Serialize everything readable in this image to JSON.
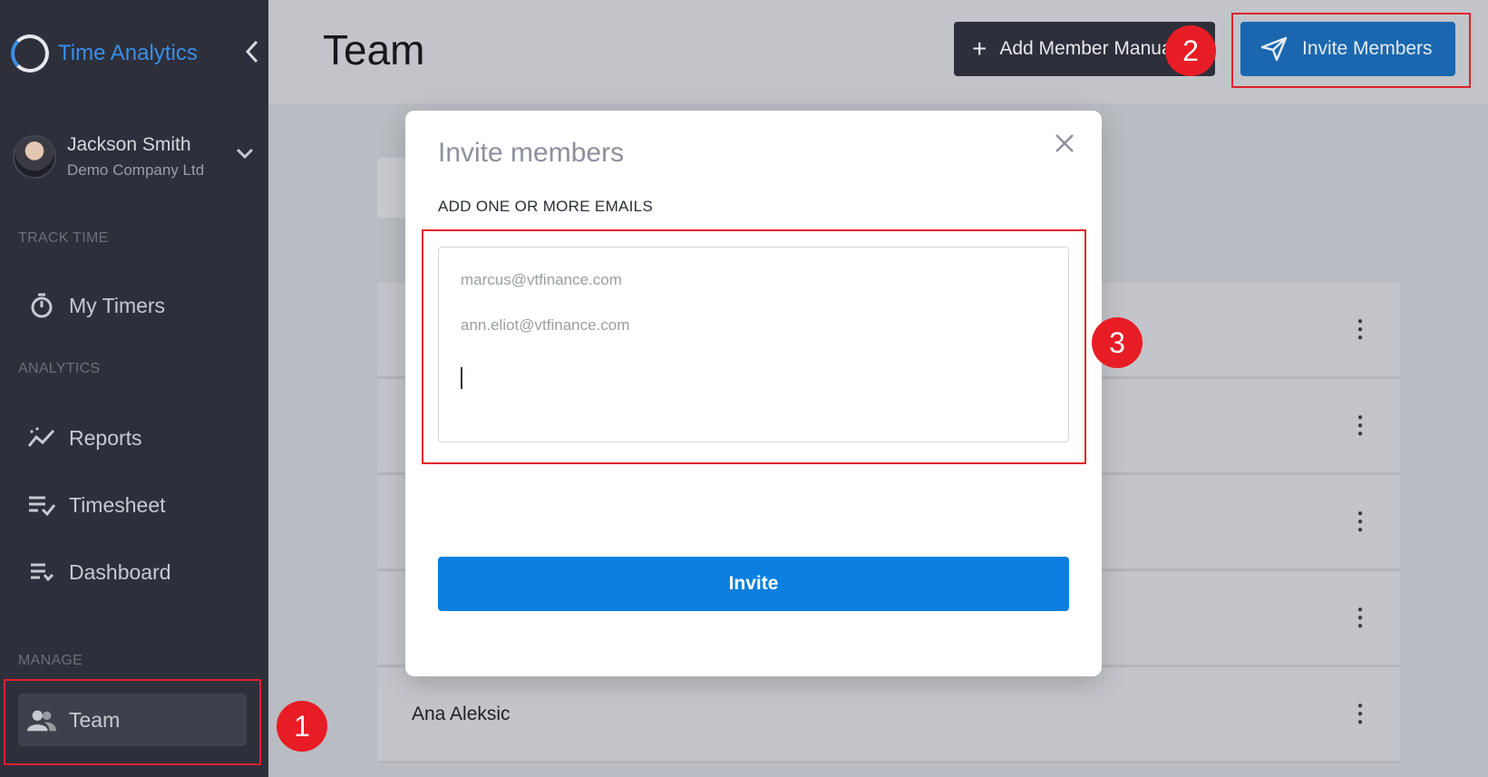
{
  "app": {
    "name": "Time Analytics",
    "collapse_icon": "chevron-left-icon"
  },
  "user": {
    "name": "Jackson Smith",
    "company": "Demo Company Ltd"
  },
  "sidebar": {
    "sections": [
      {
        "label": "TRACK TIME",
        "items": [
          {
            "label": "My Timers",
            "icon": "stopwatch-icon"
          }
        ]
      },
      {
        "label": "ANALYTICS",
        "items": [
          {
            "label": "Reports",
            "icon": "trend-icon"
          },
          {
            "label": "Timesheet",
            "icon": "list-check-icon"
          },
          {
            "label": "Dashboard",
            "icon": "list-down-icon"
          }
        ]
      },
      {
        "label": "MANAGE",
        "items": [
          {
            "label": "Team",
            "icon": "people-icon",
            "active": true
          }
        ]
      }
    ]
  },
  "header": {
    "title": "Team",
    "add_member_label": "Add Member Manually",
    "invite_members_label": "Invite Members"
  },
  "team_list": {
    "visible_name": "Ana Aleksic"
  },
  "modal": {
    "title": "Invite members",
    "field_label": "ADD ONE OR MORE EMAILS",
    "emails": [
      "marcus@vtfinance.com",
      "ann.eliot@vtfinance.com"
    ],
    "submit_label": "Invite"
  },
  "annotations": [
    "1",
    "2",
    "3"
  ],
  "colors": {
    "accent": "#0a7fe0",
    "sidebar": "#2d2f3a",
    "annotation": "#e81c25"
  }
}
